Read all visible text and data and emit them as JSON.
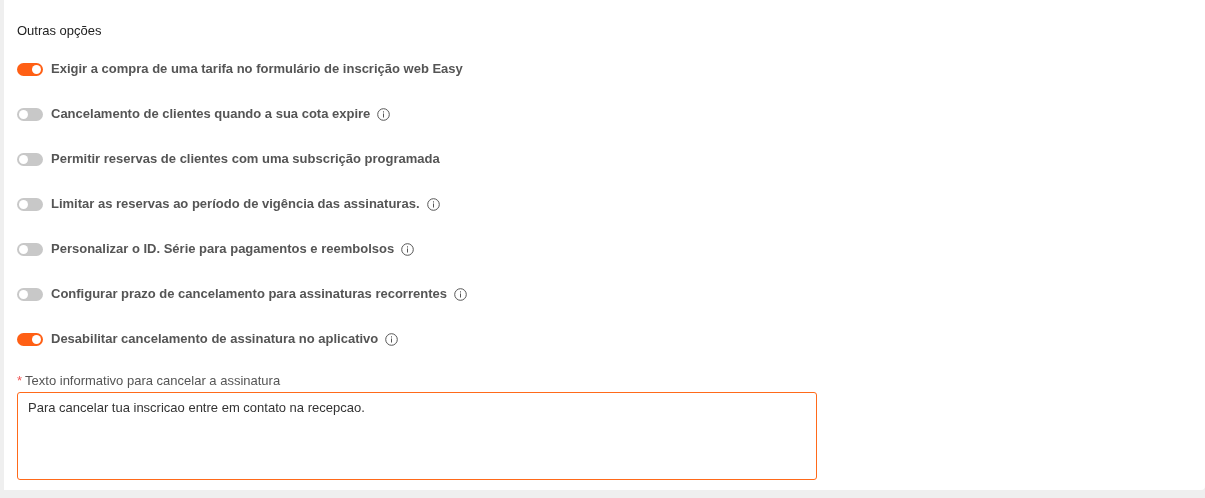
{
  "section": {
    "title": "Outras opções"
  },
  "options": [
    {
      "label": "Exigir a compra de uma tarifa no formulário de inscrição web Easy",
      "on": true,
      "info": false
    },
    {
      "label": "Cancelamento de clientes quando a sua cota expire",
      "on": false,
      "info": true
    },
    {
      "label": "Permitir reservas de clientes com uma subscrição programada",
      "on": false,
      "info": false
    },
    {
      "label": "Limitar as reservas ao período de vigência das assinaturas.",
      "on": false,
      "info": true
    },
    {
      "label": "Personalizar o ID. Série para pagamentos e reembolsos",
      "on": false,
      "info": true
    },
    {
      "label": "Configurar prazo de cancelamento para assinaturas recorrentes",
      "on": false,
      "info": true
    },
    {
      "label": "Desabilitar cancelamento de assinatura no aplicativo",
      "on": true,
      "info": true
    }
  ],
  "field": {
    "required_mark": "*",
    "label": "Texto informativo para cancelar a assinatura",
    "value": "Para cancelar tua inscricao entre em contato na recepcao."
  }
}
